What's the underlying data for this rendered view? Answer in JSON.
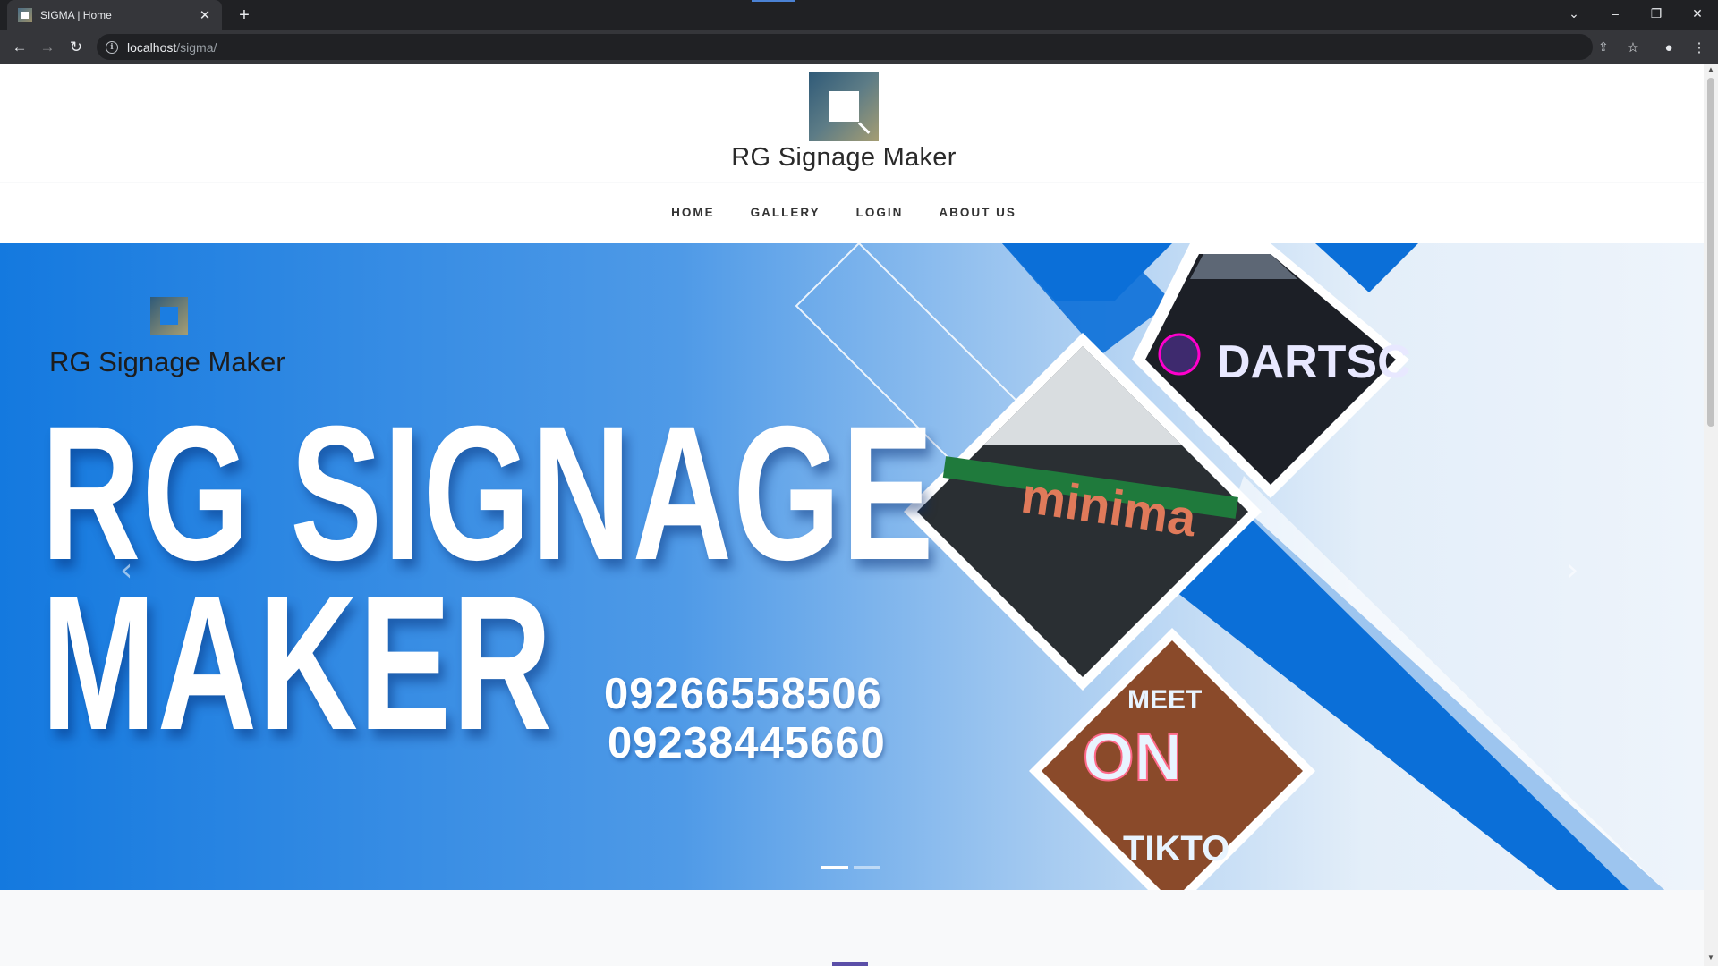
{
  "browser": {
    "tab_title": "SIGMA | Home",
    "url_host": "localhost",
    "url_path": "/sigma/",
    "new_tab_symbol": "+",
    "close_symbol": "✕"
  },
  "site": {
    "logo_text": "RG Signage Maker",
    "nav": [
      "HOME",
      "GALLERY",
      "LOGIN",
      "ABOUT US"
    ]
  },
  "hero": {
    "logo_text": "RG Signage Maker",
    "title_line1": "RG SIGNAGE",
    "title_line2": "MAKER",
    "phone1": "09266558506",
    "phone2": "09238445660",
    "photo_labels": [
      "DARTSC",
      "minima",
      "MEET ON TIKTO"
    ],
    "slides_count": 2,
    "active_slide": 1
  },
  "colors": {
    "hero_blue": "#1479df",
    "hero_light": "#eef4fb",
    "nav_text": "#333333"
  }
}
